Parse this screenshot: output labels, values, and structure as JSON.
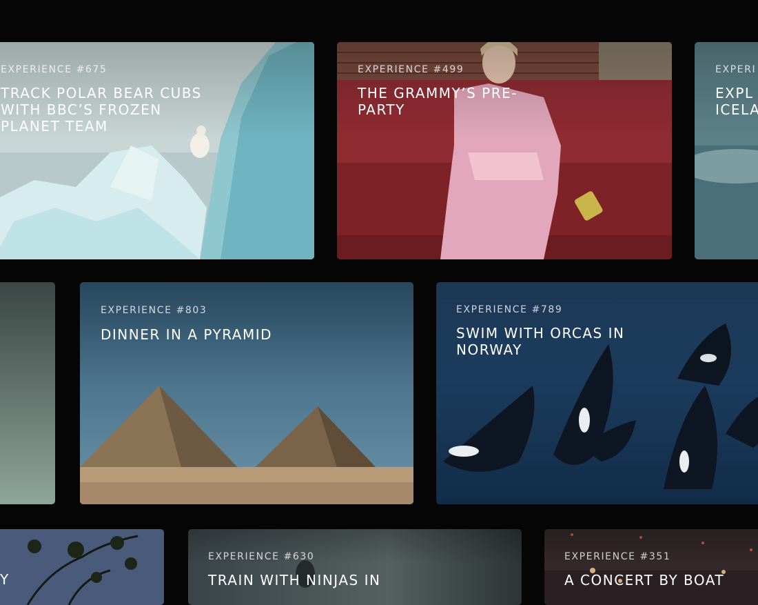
{
  "cards": [
    {
      "number": "EXPERIENCE #675",
      "title": "TRACK POLAR BEAR CUBS WITH BBC’S FROZEN PLANET TEAM"
    },
    {
      "number": "EXPERIENCE #499",
      "title": "THE GRAMMY’S PRE-PARTY"
    },
    {
      "number": "EXPERI",
      "title": "EXPL ICELA"
    },
    {
      "number": "EXPERIENCE #803",
      "title": "DINNER IN A PYRAMID"
    },
    {
      "number": "EXPERIENCE #789",
      "title": "SWIM WITH ORCAS IN NORWAY"
    },
    {
      "number": "",
      "title": "Y"
    },
    {
      "number": "EXPERIENCE #630",
      "title": "TRAIN WITH NINJAS IN"
    },
    {
      "number": "EXPERIENCE #351",
      "title": "A CONCERT BY BOAT"
    }
  ],
  "colors": {
    "background": "#050505",
    "ice": "#a9d3d8",
    "velvet": "#8a2a2e",
    "sky": "#3f6d8a",
    "sand": "#a88a6a",
    "ocean": "#1d3f5f"
  }
}
